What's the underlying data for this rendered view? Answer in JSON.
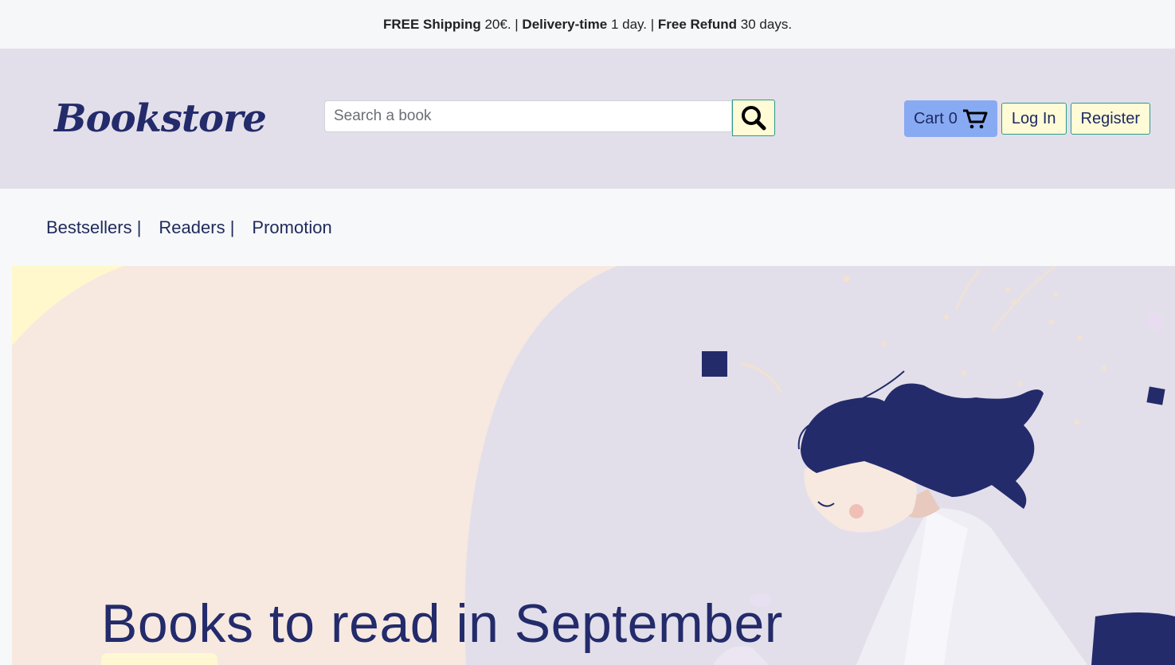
{
  "topbar": {
    "shipping_label": "FREE Shipping",
    "shipping_value": "20€.",
    "delivery_label": "Delivery-time",
    "delivery_value": "1 day.",
    "refund_label": "Free Refund",
    "refund_value": "30 days."
  },
  "header": {
    "logo": "Bookstore",
    "search_placeholder": "Search a book",
    "cart_label": "Cart",
    "cart_count": "0",
    "login": "Log In",
    "register": "Register"
  },
  "nav": {
    "items": [
      "Bestsellers |",
      "Readers |",
      "Promotion"
    ]
  },
  "hero": {
    "title": "Books to read in September"
  }
}
